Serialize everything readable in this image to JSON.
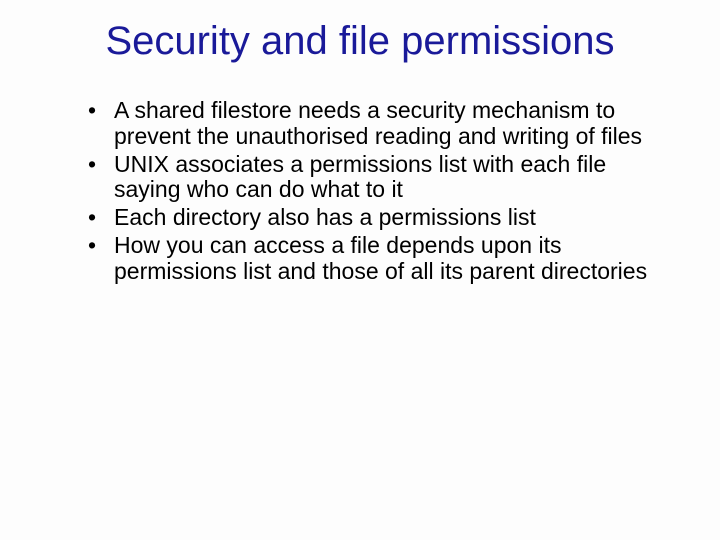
{
  "title": "Security and file permissions",
  "bullets": [
    "A shared filestore needs a security mechanism to prevent the unauthorised reading and writing of files",
    "UNIX associates a permissions list with each file saying who can do what to it",
    "Each directory also has a permissions list",
    "How you can access a file depends upon its permissions list and those of all its parent directories"
  ]
}
